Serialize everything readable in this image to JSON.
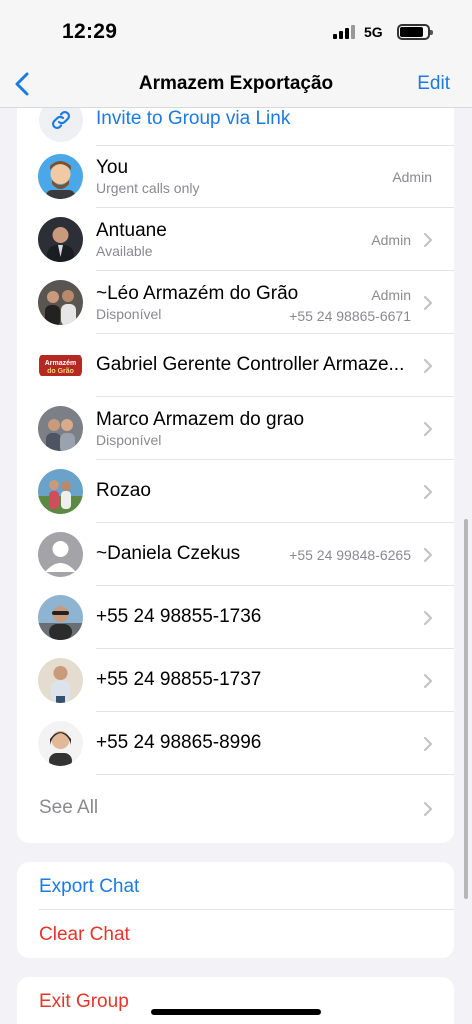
{
  "status_bar": {
    "time": "12:29",
    "network": "5G"
  },
  "nav": {
    "title": "Armazem Exportação",
    "edit_label": "Edit"
  },
  "invite": {
    "label": "Invite to Group via Link"
  },
  "members": [
    {
      "name": "You",
      "status": "Urgent calls only",
      "role": "Admin",
      "phone": "",
      "avatar": "cartoon",
      "chevron": false
    },
    {
      "name": "Antuane",
      "status": "Available",
      "role": "Admin",
      "phone": "",
      "avatar": "photo-dark",
      "chevron": true
    },
    {
      "name": "~Léo Armazém do Grão",
      "status": "Disponível",
      "role": "Admin",
      "phone": "+55 24 98865-6671",
      "avatar": "photo-group",
      "chevron": true
    },
    {
      "name": "Gabriel Gerente Controller Armaze...",
      "status": "",
      "role": "",
      "phone": "",
      "avatar": "logo-red",
      "chevron": true
    },
    {
      "name": "Marco Armazem do grao",
      "status": "Disponível",
      "role": "",
      "phone": "",
      "avatar": "photo-group2",
      "chevron": true
    },
    {
      "name": "Rozao",
      "status": "",
      "role": "",
      "phone": "",
      "avatar": "photo-outdoor",
      "chevron": true
    },
    {
      "name": "~Daniela Czekus",
      "status": "",
      "role": "",
      "phone": "+55 24 99848-6265",
      "avatar": "placeholder",
      "chevron": true
    },
    {
      "name": "+55 24 98855-1736",
      "status": "",
      "role": "",
      "phone": "",
      "avatar": "photo-city",
      "chevron": true
    },
    {
      "name": "+55 24 98855-1737",
      "status": "",
      "role": "",
      "phone": "",
      "avatar": "photo-man",
      "chevron": true
    },
    {
      "name": "+55 24 98865-8996",
      "status": "",
      "role": "",
      "phone": "",
      "avatar": "photo-woman",
      "chevron": true
    }
  ],
  "see_all": {
    "label": "See All"
  },
  "actions": {
    "export_label": "Export Chat",
    "clear_label": "Clear Chat",
    "exit_label": "Exit Group"
  },
  "colors": {
    "accent": "#1b7be3",
    "destructive": "#e5352b",
    "secondary": "#8a8a8e"
  }
}
